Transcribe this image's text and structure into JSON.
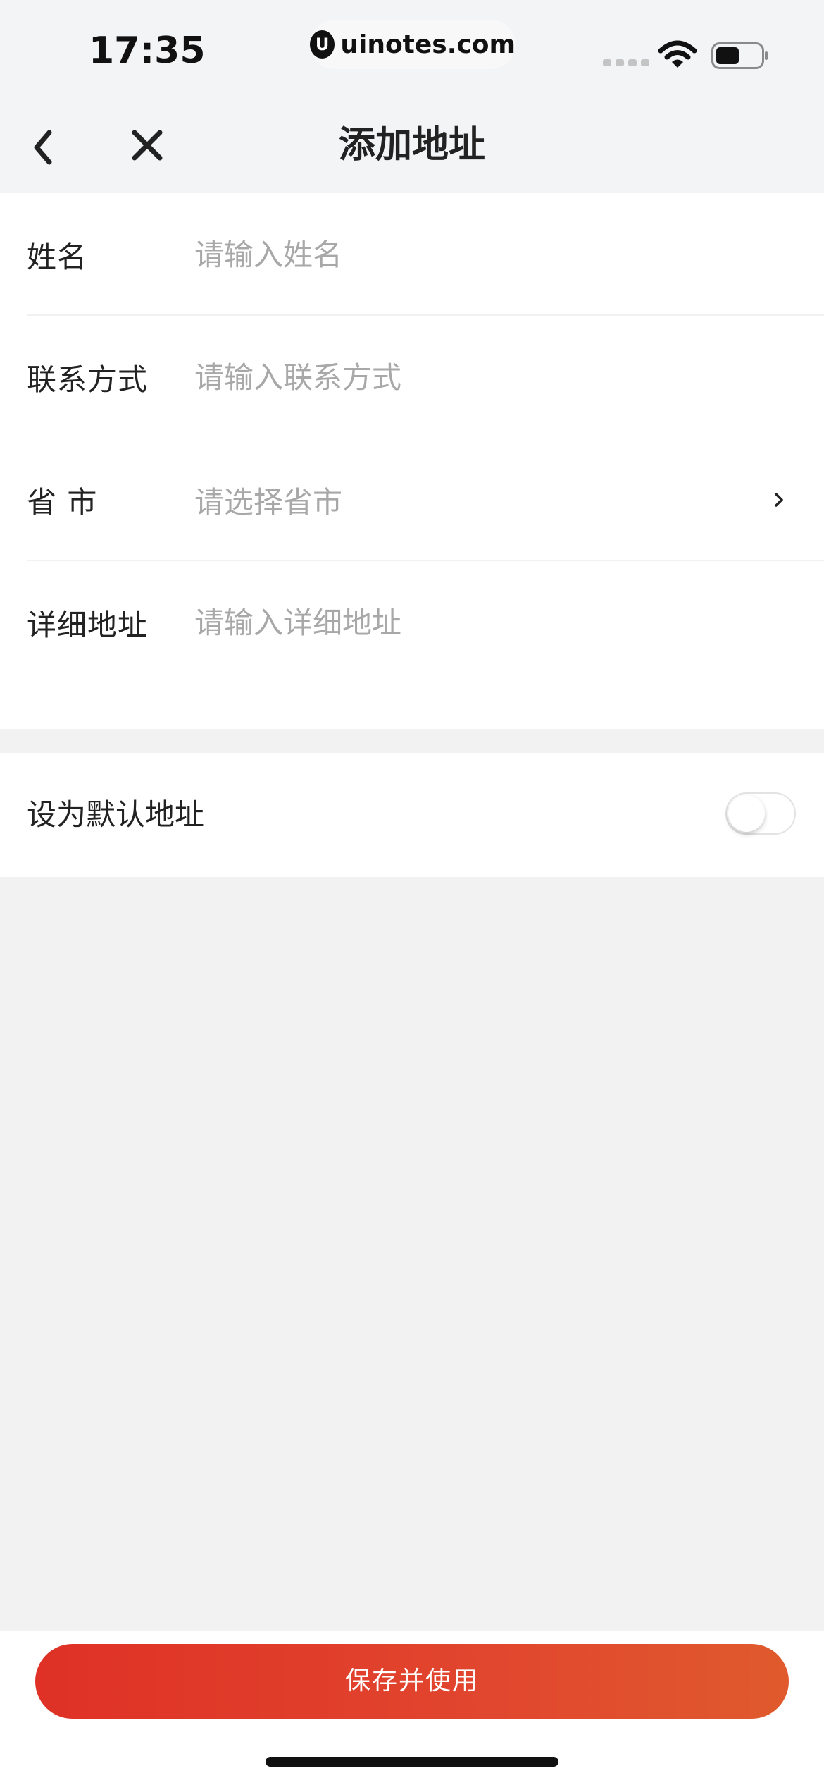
{
  "status_bar": {
    "time": "17:35",
    "watermark_logo": "U",
    "watermark": "uinotes.com"
  },
  "nav": {
    "title": "添加地址",
    "back_icon": "chevron-left-icon",
    "close_icon": "close-icon"
  },
  "form": {
    "name": {
      "label": "姓名",
      "placeholder": "请输入姓名",
      "value": ""
    },
    "contact": {
      "label": "联系方式",
      "placeholder": "请输入联系方式",
      "value": ""
    },
    "region": {
      "label": "省 市",
      "placeholder": "请选择省市",
      "icon": "chevron-right-icon"
    },
    "detail": {
      "label": "详细地址",
      "placeholder": "请输入详细地址",
      "value": ""
    }
  },
  "default_address": {
    "label": "设为默认地址",
    "enabled": false
  },
  "bottom": {
    "save_label": "保存并使用"
  },
  "colors": {
    "accent_start": "#df3126",
    "accent_end": "#e05a2d",
    "placeholder": "#a8a8a8",
    "background": "#f2f2f2"
  }
}
